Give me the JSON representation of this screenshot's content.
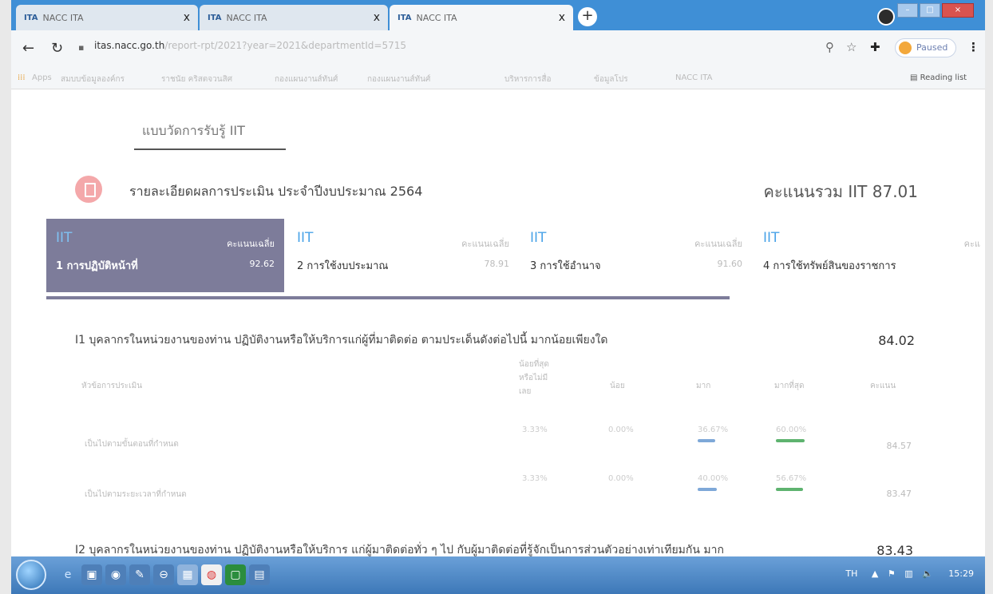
{
  "browser": {
    "tabs": [
      {
        "favicon": "ITA",
        "title": "NACC ITA"
      },
      {
        "favicon": "ITA",
        "title": "NACC ITA"
      },
      {
        "favicon": "ITA",
        "title": "NACC ITA"
      }
    ],
    "tab_close": "x",
    "new_tab": "+",
    "url_host": "itas.nacc.go.th",
    "url_path": "/report-rpt/2021?year=2021&departmentId=5715",
    "paused_label": "Paused",
    "bookmarks": [
      "Apps",
      "สมบบข้อมูลองค์กร",
      "ราชนัย คริสตจวนสิศ",
      "กองแผนงานส์ทันศ์",
      "กองแผนงานส์ทันศ์",
      "บริหารการสื่อ",
      "ข้อมูลโปร",
      "NACC ITA"
    ],
    "reading_list": "Reading list"
  },
  "page": {
    "form_title": "แบบวัดการรับรู้ IIT",
    "report_title": "รายละเอียดผลการประเมิน ประจำปีงบประมาณ 2564",
    "total_score": "คะแนนรวม IIT 87.01",
    "categories": [
      {
        "tag": "IIT",
        "avg_label": "คะแนนเฉลี่ย",
        "name": "1 การปฏิบัติหน้าที่",
        "value": "92.62",
        "active": true
      },
      {
        "tag": "IIT",
        "avg_label": "คะแนนเฉลี่ย",
        "name": "2 การใช้งบประมาณ",
        "value": "78.91",
        "active": false
      },
      {
        "tag": "IIT",
        "avg_label": "คะแนนเฉลี่ย",
        "name": "3 การใช้อำนาจ",
        "value": "91.60",
        "active": false
      },
      {
        "tag": "IIT",
        "avg_label": "คะแ",
        "name": "4 การใช้ทรัพย์สินของราชการ",
        "value": "",
        "active": false
      }
    ],
    "question1": {
      "title": "I1 บุคลากรในหน่วยงานของท่าน ปฏิบัติงานหรือให้บริการแก่ผู้ที่มาติดต่อ ตามประเด็นดังต่อไปนี้ มากน้อยเพียงใด",
      "score": "84.02",
      "headers": {
        "topic": "หัวข้อการประเมิน",
        "least_line1": "น้อยที่สุด",
        "least_line2": "หรือไม่มี",
        "least_line3": "เลย",
        "few": "น้อย",
        "much": "มาก",
        "most": "มากที่สุด",
        "score": "คะแนน"
      },
      "rows": [
        {
          "label": "เป็นไปตามขั้นตอนที่กำหนด",
          "least": "3.33%",
          "few": "0.00%",
          "much": "36.67%",
          "most": "60.00%",
          "score": "84.57",
          "much_frac": 0.3667,
          "most_frac": 0.6
        },
        {
          "label": "เป็นไปตามระยะเวลาที่กำหนด",
          "least": "3.33%",
          "few": "0.00%",
          "much": "40.00%",
          "most": "56.67%",
          "score": "83.47",
          "much_frac": 0.4,
          "most_frac": 0.5667
        }
      ]
    },
    "question2": {
      "title": "I2 บุคลากรในหน่วยงานของท่าน ปฏิบัติงานหรือให้บริการ แก่ผู้มาติดต่อทั่ว ๆ ไป กับผู้มาติดต่อที่รู้จักเป็นการส่วนตัวอย่างเท่าเทียมกัน มาก",
      "score": "83.43"
    }
  },
  "taskbar": {
    "lang": "TH",
    "time": "15:29"
  },
  "colors": {
    "active_tab": "#7d7c9a",
    "iit_blue": "#4aa3e8",
    "bar_blue": "#7ea8d8",
    "bar_green": "#5eb36f"
  }
}
